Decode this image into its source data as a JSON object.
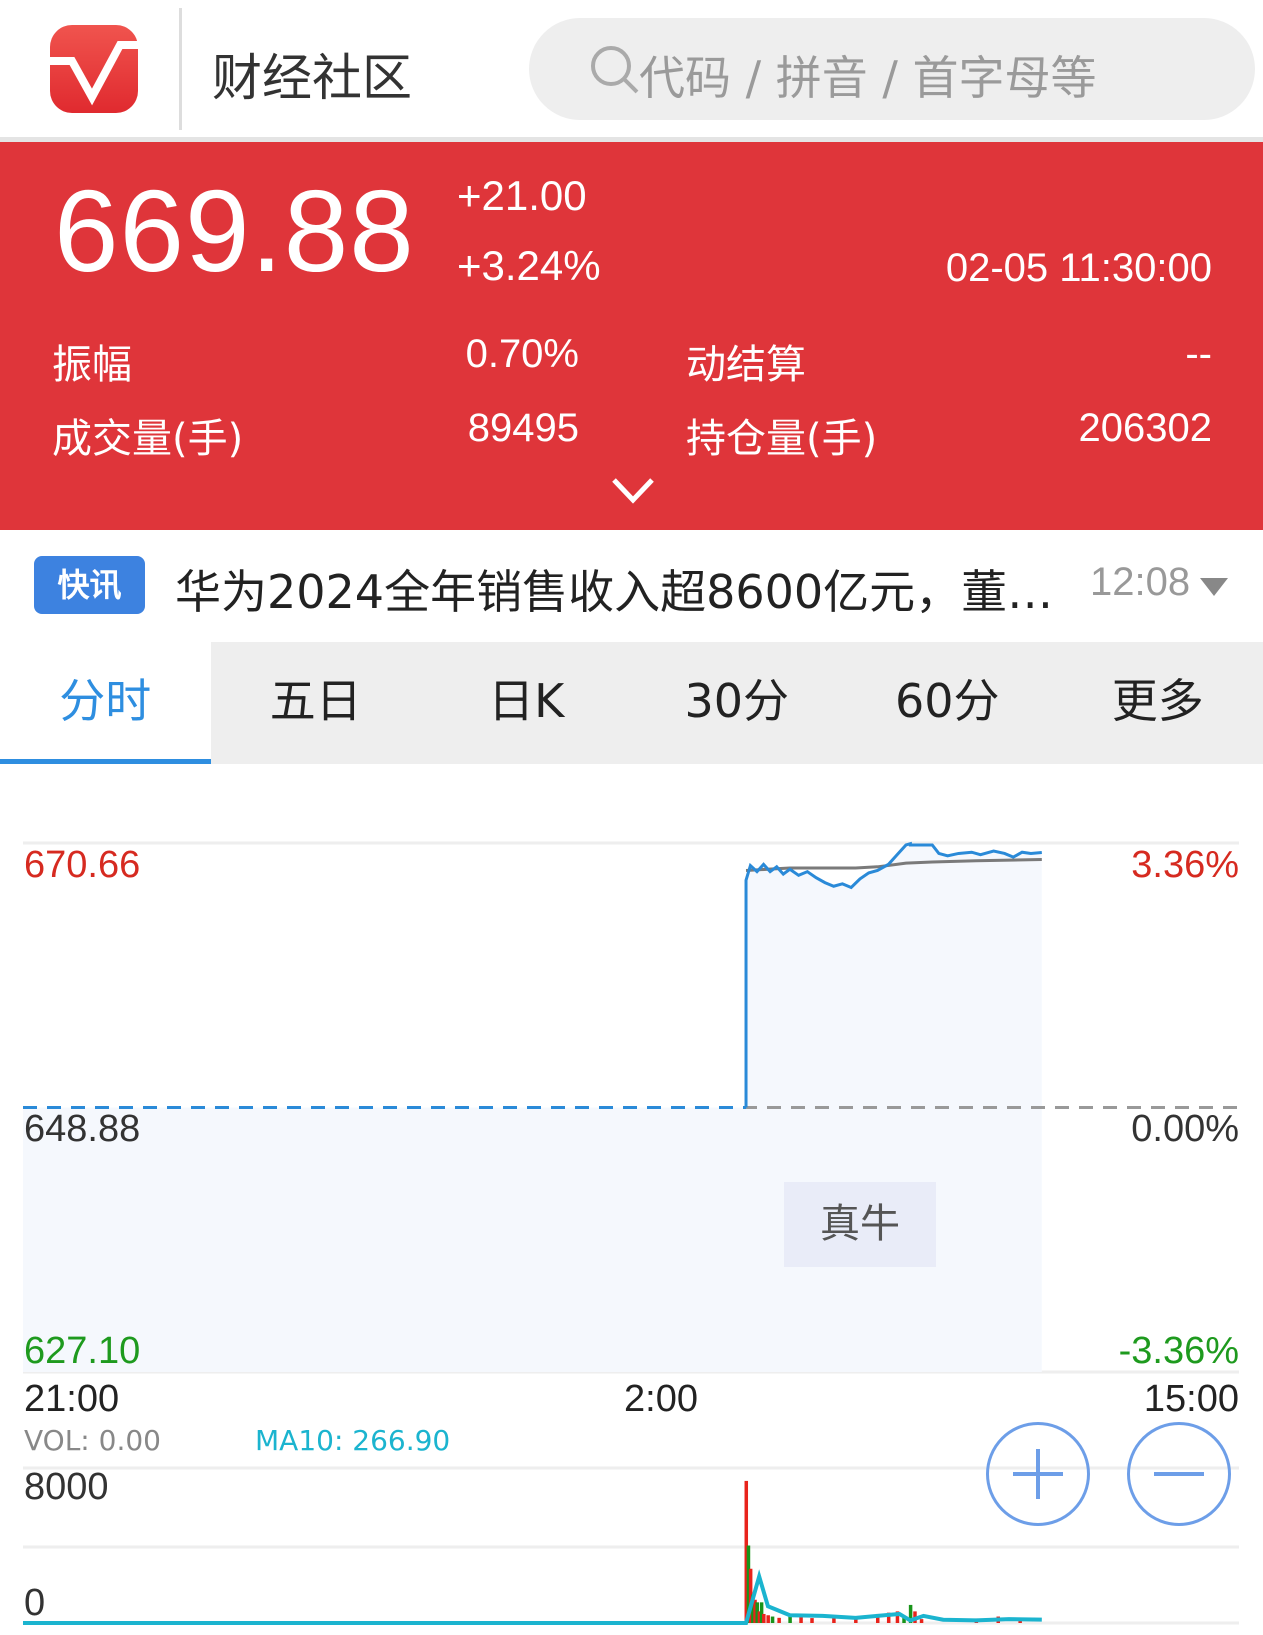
{
  "header": {
    "title": "财经社区",
    "search_placeholder": "代码 / 拼音 / 首字母等",
    "logo_icon": "check-v-logo",
    "search_icon": "magnifier-icon"
  },
  "quote": {
    "price": "669.88",
    "change": "+21.00",
    "change_pct": "+3.24%",
    "datetime": "02-05 11:30:00",
    "stats": [
      {
        "label": "振幅",
        "value": "0.70%"
      },
      {
        "label": "动结算",
        "value": "--"
      },
      {
        "label": "成交量(手)",
        "value": "89495"
      },
      {
        "label": "持仓量(手)",
        "value": "206302"
      }
    ],
    "expand_icon": "chevron-down-icon",
    "color": "#df353a"
  },
  "news": {
    "badge": "快讯",
    "text": "华为2024全年销售收入超8600亿元，董…",
    "time": "12:08"
  },
  "tabs": [
    {
      "label": "分时",
      "active": true
    },
    {
      "label": "五日"
    },
    {
      "label": "日K"
    },
    {
      "label": "30分"
    },
    {
      "label": "60分"
    },
    {
      "label": "更多"
    }
  ],
  "chart_data": {
    "type": "line",
    "y_labels_left": {
      "top": "670.66",
      "mid": "648.88",
      "bottom": "627.10"
    },
    "y_labels_right": {
      "top": "3.36%",
      "mid": "0.00%",
      "bottom": "-3.36%"
    },
    "ylim": [
      627.1,
      670.66
    ],
    "prev_settle": 648.88,
    "x_labels": [
      "21:00",
      "2:00",
      "15:00"
    ],
    "sessions": "21:00-02:30, 09:00-10:15, 10:30-11:30, 13:30-15:00",
    "price": [
      [
        "09:00",
        667.6
      ],
      [
        "09:02",
        668.8
      ],
      [
        "09:05",
        668.3
      ],
      [
        "09:08",
        668.9
      ],
      [
        "09:11",
        668.3
      ],
      [
        "09:14",
        668.7
      ],
      [
        "09:17",
        668.1
      ],
      [
        "09:20",
        668.5
      ],
      [
        "09:24",
        668.0
      ],
      [
        "09:28",
        668.3
      ],
      [
        "09:32",
        667.8
      ],
      [
        "09:36",
        667.4
      ],
      [
        "09:40",
        667.1
      ],
      [
        "09:44",
        667.3
      ],
      [
        "09:48",
        667.0
      ],
      [
        "09:52",
        667.7
      ],
      [
        "09:56",
        668.2
      ],
      [
        "10:00",
        668.4
      ],
      [
        "10:05",
        668.9
      ],
      [
        "10:09",
        669.7
      ],
      [
        "10:13",
        670.5
      ],
      [
        "10:15",
        670.6
      ],
      [
        "10:30",
        670.5
      ],
      [
        "10:40",
        670.5
      ],
      [
        "10:43",
        669.8
      ],
      [
        "10:47",
        669.6
      ],
      [
        "10:52",
        669.8
      ],
      [
        "10:58",
        669.9
      ],
      [
        "11:02",
        669.7
      ],
      [
        "11:08",
        670.0
      ],
      [
        "11:13",
        669.8
      ],
      [
        "11:17",
        669.5
      ],
      [
        "11:21",
        669.9
      ],
      [
        "11:25",
        669.8
      ],
      [
        "11:30",
        669.88
      ]
    ],
    "average": [
      [
        "09:00",
        668.4
      ],
      [
        "09:20",
        668.6
      ],
      [
        "09:50",
        668.6
      ],
      [
        "10:00",
        668.7
      ],
      [
        "10:13",
        669.0
      ],
      [
        "10:40",
        669.1
      ],
      [
        "11:00",
        669.2
      ],
      [
        "11:30",
        669.3
      ]
    ],
    "colors": {
      "price": "#2a8ad8",
      "average": "#7a7a7a",
      "up": "#e8231b",
      "down": "#19941a",
      "ma": "#1bb4cf",
      "axis_up": "#d62a20",
      "axis_down": "#1e9a1e"
    },
    "volume": {
      "vol_label": "VOL: 0.00",
      "ma_label": "MA10: 266.90",
      "y_top": "8000",
      "y_bottom": "0",
      "ylim": [
        0,
        12000
      ],
      "bars": [
        [
          "09:00",
          11000,
          "up"
        ],
        [
          "09:01",
          6000,
          "down"
        ],
        [
          "09:02",
          4200,
          "up"
        ],
        [
          "09:03",
          2200,
          "down"
        ],
        [
          "09:04",
          1800,
          "up"
        ],
        [
          "09:05",
          1600,
          "down"
        ],
        [
          "09:06",
          900,
          "up"
        ],
        [
          "09:07",
          1600,
          "down"
        ],
        [
          "09:08",
          700,
          "up"
        ],
        [
          "09:10",
          600,
          "up"
        ],
        [
          "09:12",
          500,
          "down"
        ],
        [
          "09:15",
          400,
          "up"
        ],
        [
          "09:20",
          500,
          "down"
        ],
        [
          "09:25",
          450,
          "up"
        ],
        [
          "09:30",
          380,
          "up"
        ],
        [
          "09:40",
          500,
          "up"
        ],
        [
          "09:50",
          400,
          "up"
        ],
        [
          "10:00",
          700,
          "up"
        ],
        [
          "10:05",
          800,
          "up"
        ],
        [
          "10:09",
          900,
          "up"
        ],
        [
          "10:12",
          500,
          "down"
        ],
        [
          "10:30",
          1400,
          "down"
        ],
        [
          "10:32",
          900,
          "up"
        ],
        [
          "10:35",
          300,
          "up"
        ],
        [
          "11:00",
          350,
          "up"
        ],
        [
          "11:10",
          500,
          "up"
        ],
        [
          "11:20",
          250,
          "up"
        ]
      ],
      "ma10": [
        [
          "09:00",
          0
        ],
        [
          "09:06",
          3600
        ],
        [
          "09:10",
          1300
        ],
        [
          "09:20",
          600
        ],
        [
          "09:35",
          550
        ],
        [
          "09:50",
          400
        ],
        [
          "10:10",
          700
        ],
        [
          "10:15",
          200
        ],
        [
          "10:30",
          200
        ],
        [
          "10:36",
          550
        ],
        [
          "10:45",
          250
        ],
        [
          "11:00",
          200
        ],
        [
          "11:15",
          300
        ],
        [
          "11:30",
          260
        ]
      ]
    },
    "annotation": "真牛",
    "zoom_in_icon": "plus-circle-icon",
    "zoom_out_icon": "minus-circle-icon"
  }
}
